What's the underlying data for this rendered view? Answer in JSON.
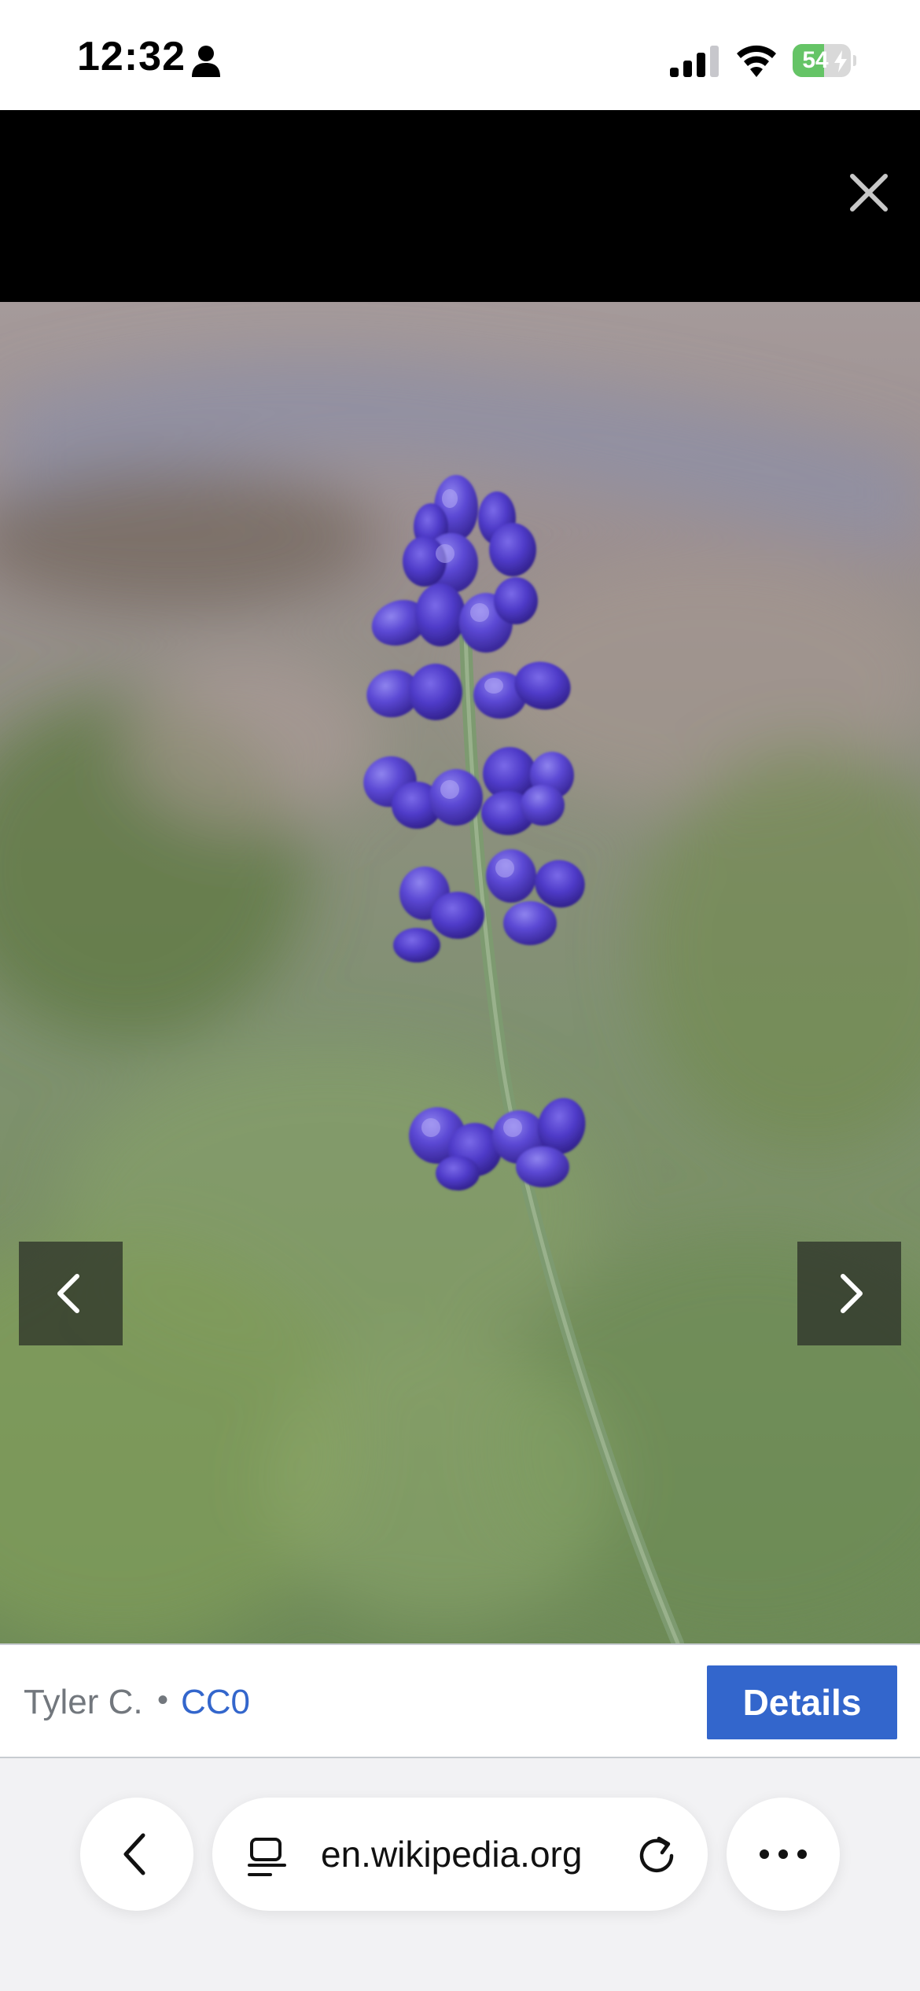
{
  "status_bar": {
    "time": "12:32",
    "battery_level": "54",
    "battery_fraction": 0.54,
    "icons": [
      "person-icon",
      "cellular-signal-icon",
      "wifi-icon",
      "battery-icon",
      "charging-bolt-icon"
    ]
  },
  "viewer": {
    "close_icon": "close-icon",
    "prev_icon": "chevron-left-icon",
    "next_icon": "chevron-right-icon",
    "image_subject": "lavender flower spike"
  },
  "caption": {
    "author": "Tyler C.",
    "separator": "•",
    "license": "CC0",
    "details_label": "Details"
  },
  "browser_toolbar": {
    "back_icon": "back-chevron-icon",
    "page_icon": "page-menu-icon",
    "url": "en.wikipedia.org",
    "reload_icon": "reload-icon",
    "more_icon": "more-icon"
  },
  "colors": {
    "accent": "#3366cc",
    "muted_text": "#72777d",
    "battery_green": "#65c466",
    "header_black": "#000000"
  }
}
